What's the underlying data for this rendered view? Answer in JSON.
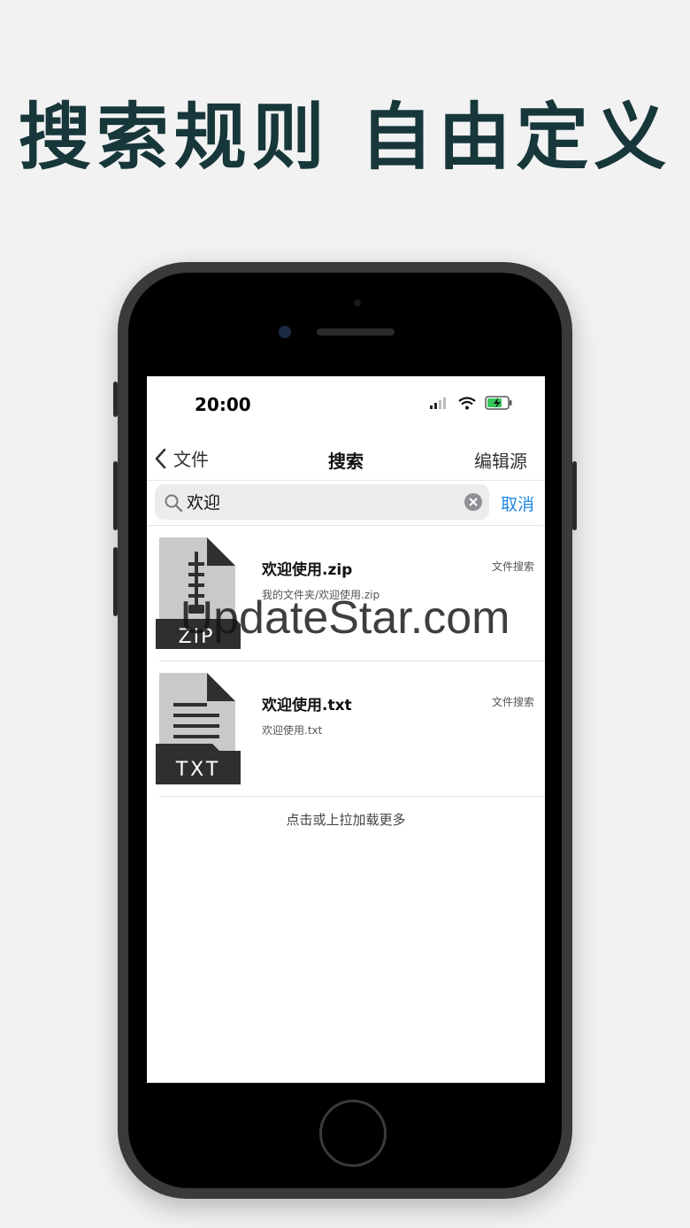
{
  "headline": "搜索规则 自由定义",
  "status_bar": {
    "time": "20:00"
  },
  "navbar": {
    "back_label": "文件",
    "title": "搜索",
    "right_label": "编辑源"
  },
  "search": {
    "query": "欢迎",
    "placeholder": "",
    "cancel_label": "取消"
  },
  "results": [
    {
      "name": "欢迎使用.zip",
      "path": "我的文件夹/欢迎使用.zip",
      "tag": "文件搜索",
      "icon": "zip-file-icon",
      "icon_label": "ZIP"
    },
    {
      "name": "欢迎使用.txt",
      "path": "欢迎使用.txt",
      "tag": "文件搜索",
      "icon": "txt-file-icon",
      "icon_label": "TXT"
    }
  ],
  "load_more": "点击或上拉加载更多",
  "watermark": "UpdateStar.com",
  "colors": {
    "headline": "#17373a",
    "accent": "#1e88e5",
    "battery": "#34c759"
  }
}
